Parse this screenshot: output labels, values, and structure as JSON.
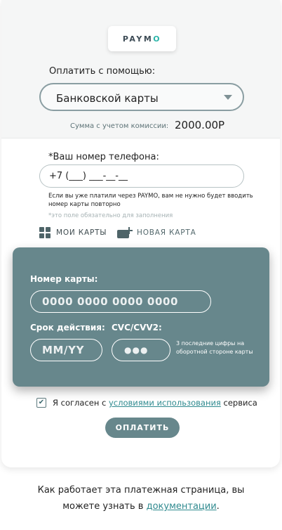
{
  "logo": {
    "brand": "PAYMO",
    "brand_main": "PAYM",
    "brand_accent": "O"
  },
  "payment": {
    "pay_with_label": "Оплатить с помощью:",
    "method_selected": "Банковской карты",
    "commission_label": "Сумма с учетом комиссии:",
    "amount": "2000.00Р"
  },
  "phone": {
    "label": "*Ваш номер телефона:",
    "value": "+7 (___) ___-__-__",
    "hint": "Если вы уже платили через PAYMO, вам не нужно будет вводить номер карты повторно",
    "required_note": "*это поле обязательно для заполнения"
  },
  "tabs": {
    "my_cards": "МОИ КАРТЫ",
    "new_card": "НОВАЯ КАРТА"
  },
  "card_form": {
    "card_number_label": "Номер карты:",
    "card_number_placeholder": "0000 0000 0000 0000",
    "expiry_label": "Срок действия:",
    "expiry_placeholder": "MM/YY",
    "cvc_label": "CVC/CVV2:",
    "cvc_placeholder": "●●●",
    "cvc_hint": "3 последние цифры на оборотной стороне карты"
  },
  "agreement": {
    "checked": true,
    "prefix": "Я согласен с ",
    "link": "условиями использования",
    "suffix": " сервиса"
  },
  "pay_button": "ОПЛАТИТЬ",
  "footer": {
    "text": "Как работает эта платежная страница, вы можете узнать в ",
    "link": "документации",
    "end": "."
  },
  "colors": {
    "panel": "#67878c",
    "accent_link": "#2f8a8f",
    "logo_accent": "#2bb5a9"
  },
  "icons": [
    "grid-icon",
    "add-card-icon",
    "chevron-down-icon",
    "checkmark-icon"
  ]
}
